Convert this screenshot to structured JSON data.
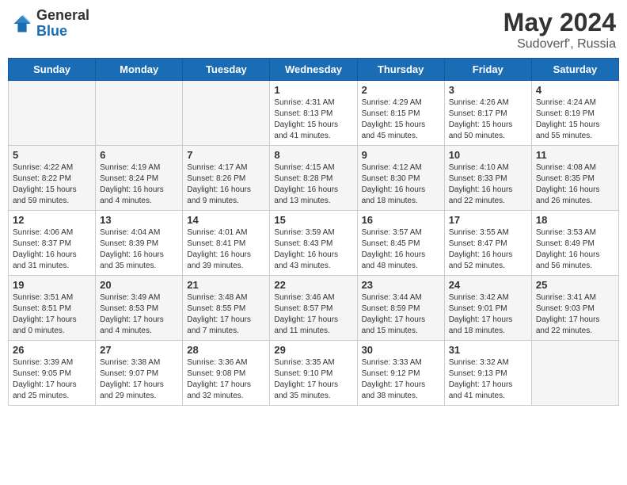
{
  "header": {
    "logo_general": "General",
    "logo_blue": "Blue",
    "month_title": "May 2024",
    "subtitle": "Sudoverf', Russia"
  },
  "days_of_week": [
    "Sunday",
    "Monday",
    "Tuesday",
    "Wednesday",
    "Thursday",
    "Friday",
    "Saturday"
  ],
  "weeks": [
    {
      "days": [
        {
          "number": "",
          "empty": true
        },
        {
          "number": "",
          "empty": true
        },
        {
          "number": "",
          "empty": true
        },
        {
          "number": "1",
          "sunrise": "4:31 AM",
          "sunset": "8:13 PM",
          "daylight": "15 hours and 41 minutes."
        },
        {
          "number": "2",
          "sunrise": "4:29 AM",
          "sunset": "8:15 PM",
          "daylight": "15 hours and 45 minutes."
        },
        {
          "number": "3",
          "sunrise": "4:26 AM",
          "sunset": "8:17 PM",
          "daylight": "15 hours and 50 minutes."
        },
        {
          "number": "4",
          "sunrise": "4:24 AM",
          "sunset": "8:19 PM",
          "daylight": "15 hours and 55 minutes."
        }
      ]
    },
    {
      "days": [
        {
          "number": "5",
          "sunrise": "4:22 AM",
          "sunset": "8:22 PM",
          "daylight": "15 hours and 59 minutes."
        },
        {
          "number": "6",
          "sunrise": "4:19 AM",
          "sunset": "8:24 PM",
          "daylight": "16 hours and 4 minutes."
        },
        {
          "number": "7",
          "sunrise": "4:17 AM",
          "sunset": "8:26 PM",
          "daylight": "16 hours and 9 minutes."
        },
        {
          "number": "8",
          "sunrise": "4:15 AM",
          "sunset": "8:28 PM",
          "daylight": "16 hours and 13 minutes."
        },
        {
          "number": "9",
          "sunrise": "4:12 AM",
          "sunset": "8:30 PM",
          "daylight": "16 hours and 18 minutes."
        },
        {
          "number": "10",
          "sunrise": "4:10 AM",
          "sunset": "8:33 PM",
          "daylight": "16 hours and 22 minutes."
        },
        {
          "number": "11",
          "sunrise": "4:08 AM",
          "sunset": "8:35 PM",
          "daylight": "16 hours and 26 minutes."
        }
      ]
    },
    {
      "days": [
        {
          "number": "12",
          "sunrise": "4:06 AM",
          "sunset": "8:37 PM",
          "daylight": "16 hours and 31 minutes."
        },
        {
          "number": "13",
          "sunrise": "4:04 AM",
          "sunset": "8:39 PM",
          "daylight": "16 hours and 35 minutes."
        },
        {
          "number": "14",
          "sunrise": "4:01 AM",
          "sunset": "8:41 PM",
          "daylight": "16 hours and 39 minutes."
        },
        {
          "number": "15",
          "sunrise": "3:59 AM",
          "sunset": "8:43 PM",
          "daylight": "16 hours and 43 minutes."
        },
        {
          "number": "16",
          "sunrise": "3:57 AM",
          "sunset": "8:45 PM",
          "daylight": "16 hours and 48 minutes."
        },
        {
          "number": "17",
          "sunrise": "3:55 AM",
          "sunset": "8:47 PM",
          "daylight": "16 hours and 52 minutes."
        },
        {
          "number": "18",
          "sunrise": "3:53 AM",
          "sunset": "8:49 PM",
          "daylight": "16 hours and 56 minutes."
        }
      ]
    },
    {
      "days": [
        {
          "number": "19",
          "sunrise": "3:51 AM",
          "sunset": "8:51 PM",
          "daylight": "17 hours and 0 minutes."
        },
        {
          "number": "20",
          "sunrise": "3:49 AM",
          "sunset": "8:53 PM",
          "daylight": "17 hours and 4 minutes."
        },
        {
          "number": "21",
          "sunrise": "3:48 AM",
          "sunset": "8:55 PM",
          "daylight": "17 hours and 7 minutes."
        },
        {
          "number": "22",
          "sunrise": "3:46 AM",
          "sunset": "8:57 PM",
          "daylight": "17 hours and 11 minutes."
        },
        {
          "number": "23",
          "sunrise": "3:44 AM",
          "sunset": "8:59 PM",
          "daylight": "17 hours and 15 minutes."
        },
        {
          "number": "24",
          "sunrise": "3:42 AM",
          "sunset": "9:01 PM",
          "daylight": "17 hours and 18 minutes."
        },
        {
          "number": "25",
          "sunrise": "3:41 AM",
          "sunset": "9:03 PM",
          "daylight": "17 hours and 22 minutes."
        }
      ]
    },
    {
      "days": [
        {
          "number": "26",
          "sunrise": "3:39 AM",
          "sunset": "9:05 PM",
          "daylight": "17 hours and 25 minutes."
        },
        {
          "number": "27",
          "sunrise": "3:38 AM",
          "sunset": "9:07 PM",
          "daylight": "17 hours and 29 minutes."
        },
        {
          "number": "28",
          "sunrise": "3:36 AM",
          "sunset": "9:08 PM",
          "daylight": "17 hours and 32 minutes."
        },
        {
          "number": "29",
          "sunrise": "3:35 AM",
          "sunset": "9:10 PM",
          "daylight": "17 hours and 35 minutes."
        },
        {
          "number": "30",
          "sunrise": "3:33 AM",
          "sunset": "9:12 PM",
          "daylight": "17 hours and 38 minutes."
        },
        {
          "number": "31",
          "sunrise": "3:32 AM",
          "sunset": "9:13 PM",
          "daylight": "17 hours and 41 minutes."
        },
        {
          "number": "",
          "empty": true
        }
      ]
    }
  ]
}
